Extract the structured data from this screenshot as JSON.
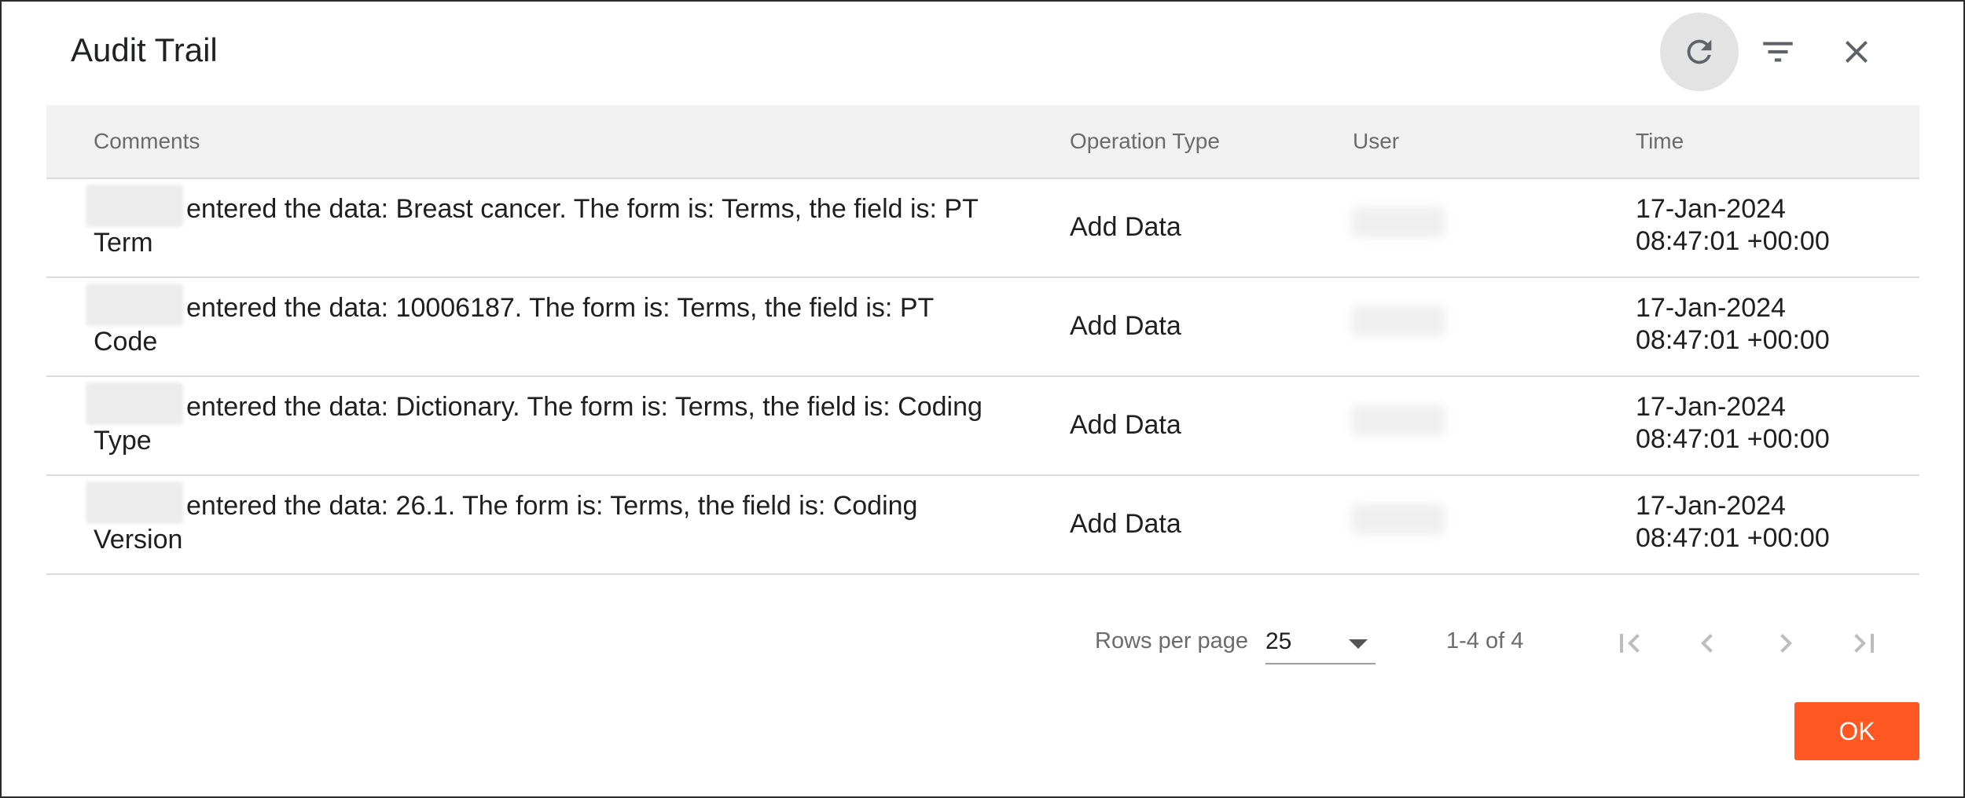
{
  "dialog": {
    "title": "Audit Trail",
    "actions": {
      "refresh_icon": "refresh-icon",
      "filter_icon": "filter-icon",
      "close_icon": "close-icon"
    }
  },
  "table": {
    "columns": [
      "Comments",
      "Operation Type",
      "User",
      "Time"
    ],
    "rows": [
      {
        "comment_line1": "entered the data: Breast cancer. The form is: Terms, the field is: PT",
        "comment_line2": "Term",
        "operation": "Add Data",
        "time_line1": "17-Jan-2024",
        "time_line2": "08:47:01 +00:00"
      },
      {
        "comment_line1": "entered the data: 10006187. The form is: Terms, the field is: PT",
        "comment_line2": "Code",
        "operation": "Add Data",
        "time_line1": "17-Jan-2024",
        "time_line2": "08:47:01 +00:00"
      },
      {
        "comment_line1": "entered the data: Dictionary. The form is: Terms, the field is: Coding",
        "comment_line2": "Type",
        "operation": "Add Data",
        "time_line1": "17-Jan-2024",
        "time_line2": "08:47:01 +00:00"
      },
      {
        "comment_line1": "entered the data: 26.1. The form is: Terms, the field is: Coding",
        "comment_line2": "Version",
        "operation": "Add Data",
        "time_line1": "17-Jan-2024",
        "time_line2": "08:47:01 +00:00"
      }
    ]
  },
  "pagination": {
    "rows_per_page_label": "Rows per page",
    "rows_per_page_value": "25",
    "range_text": "1-4 of 4"
  },
  "footer": {
    "ok_label": "OK"
  },
  "colors": {
    "accent": "#ff5722",
    "header_bg": "#f1f1f1",
    "refresh_bg": "#e3e3e3"
  }
}
